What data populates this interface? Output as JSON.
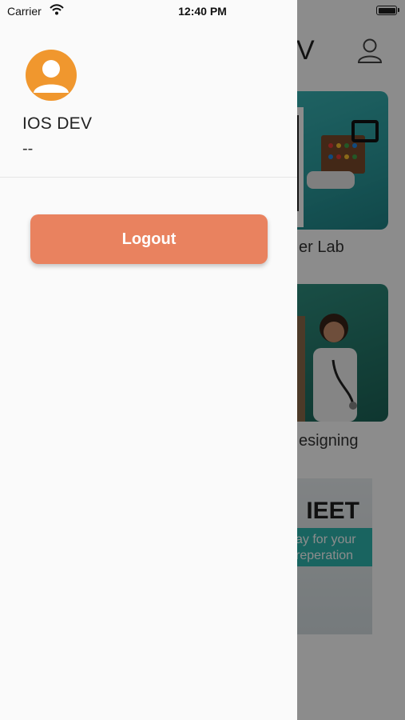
{
  "status_bar": {
    "carrier": "Carrier",
    "time": "12:40 PM"
  },
  "background": {
    "title_fragment": "V",
    "cards": [
      {
        "caption": "er Lab"
      },
      {
        "caption": "esigning"
      },
      {
        "headline": "IEET",
        "line1": "ay for your",
        "line2": "reperation"
      }
    ]
  },
  "drawer": {
    "user_name": "IOS DEV",
    "user_subtitle": "--",
    "logout_label": "Logout"
  },
  "colors": {
    "accent": "#e9825f",
    "avatar_bg": "#f0972e",
    "card_teal": "#38b3b4"
  }
}
